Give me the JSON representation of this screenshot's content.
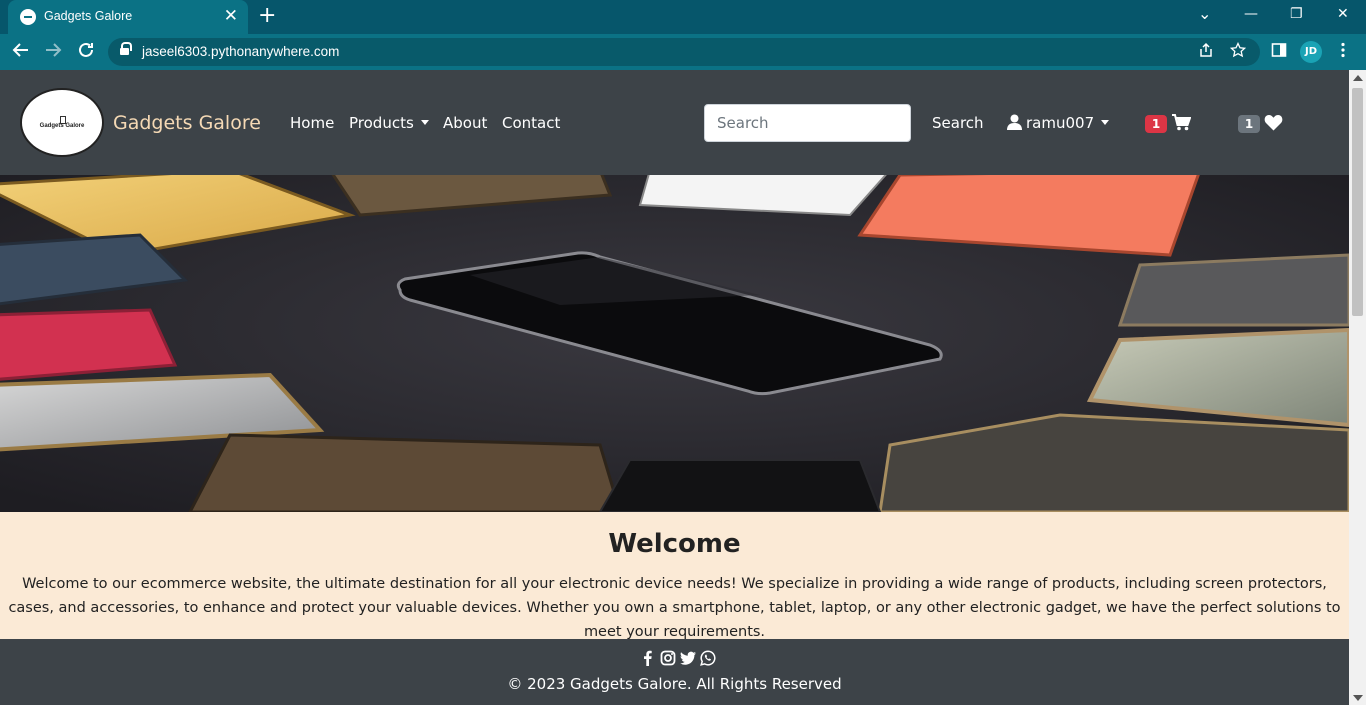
{
  "browser": {
    "tab_title": "Gadgets Galore",
    "tab_close": "✕",
    "new_tab": "+",
    "url": "jaseel6303.pythonanywhere.com",
    "profile_initials": "JD",
    "win_minimize": "—",
    "win_restore": "❐",
    "win_close": "✕",
    "win_menu": "⌄"
  },
  "navbar": {
    "logo_text": "Gadgets Galore",
    "brand": "Gadgets Galore",
    "links": [
      "Home",
      "Products",
      "About",
      "Contact"
    ],
    "search_placeholder": "Search",
    "search_button": "Search",
    "username": "ramu007",
    "cart_count": "1",
    "wishlist_count": "1",
    "cart_badge_color": "#dc3545",
    "wishlist_badge_color": "#6c757d"
  },
  "welcome": {
    "title": "Welcome",
    "text": "Welcome to our ecommerce website, the ultimate destination for all your electronic device needs! We specialize in providing a wide range of products, including screen protectors, cases, and accessories, to enhance and protect your valuable devices. Whether you own a smartphone, tablet, laptop, or any other electronic gadget, we have the perfect solutions to meet your requirements."
  },
  "footer": {
    "copyright": "© 2023 Gadgets Galore. All Rights Reserved",
    "social_icons": [
      "facebook-icon",
      "instagram-icon",
      "twitter-icon",
      "whatsapp-icon"
    ]
  },
  "colors": {
    "chrome_dark": "#06566b",
    "chrome_toolbar": "#0b7285",
    "navbar_bg": "#3d4348",
    "welcome_bg": "#fbead6",
    "brand_color": "#f5d9b5"
  }
}
